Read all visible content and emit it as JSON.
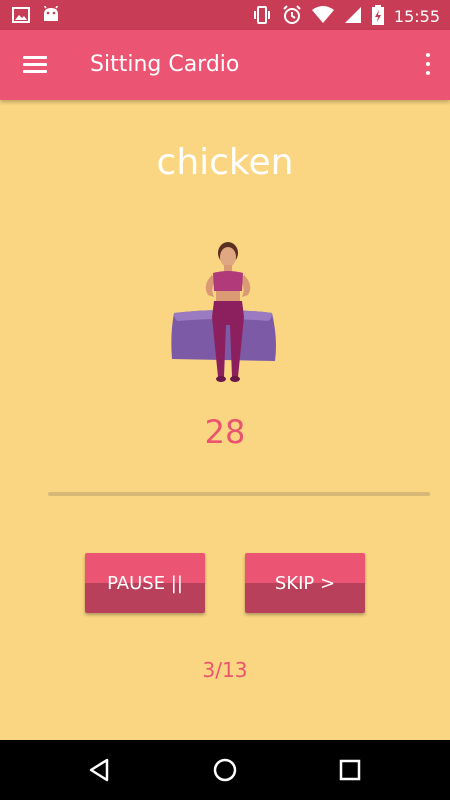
{
  "status_bar": {
    "time": "15:55",
    "left_icons": [
      "image-icon",
      "android-icon"
    ],
    "right_icons": [
      "vibrate-icon",
      "alarm-icon",
      "wifi-icon",
      "signal-icon",
      "battery-icon"
    ]
  },
  "app_bar": {
    "title": "Sitting Cardio",
    "color": "#ec5474"
  },
  "exercise": {
    "name": "chicken",
    "timer": "28",
    "progress_fraction": 0.0,
    "counter": "3/13"
  },
  "controls": {
    "pause_label": "PAUSE ||",
    "skip_label": "SKIP >"
  },
  "colors": {
    "background": "#fad682",
    "accent": "#ec5474",
    "status_bar": "#c83c56"
  }
}
